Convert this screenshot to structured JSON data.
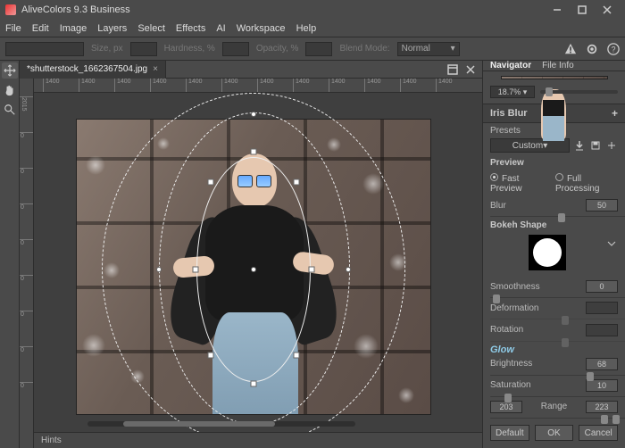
{
  "app": {
    "title": "AliveColors 9.3 Business"
  },
  "menu": [
    "File",
    "Edit",
    "Image",
    "Layers",
    "Select",
    "Effects",
    "AI",
    "Workspace",
    "Help"
  ],
  "options_bar": {
    "size_label": "Size, px",
    "hardness_label": "Hardness, %",
    "opacity_label": "Opacity, %",
    "blend_label": "Blend Mode:",
    "blend_value": "Normal"
  },
  "document": {
    "tab_name": "*shutterstock_1662367504.jpg"
  },
  "ruler_ticks": [
    "1400",
    "1400",
    "1400",
    "1400",
    "1400",
    "1400",
    "1400",
    "1400",
    "1400",
    "1400",
    "1400",
    "1400"
  ],
  "hints": {
    "label": "Hints"
  },
  "navigator": {
    "tabs": [
      "Navigator",
      "File Info"
    ],
    "zoom": "18.7%"
  },
  "iris_blur": {
    "title": "Iris Blur",
    "presets_label": "Presets",
    "preset_value": "Custom",
    "preview_label": "Preview",
    "fast_preview": "Fast Preview",
    "full_processing": "Full Processing",
    "blur_label": "Blur",
    "blur_value": "50",
    "bokeh_label": "Bokeh Shape",
    "smoothness_label": "Smoothness",
    "smoothness_value": "0",
    "deformation_label": "Deformation",
    "rotation_label": "Rotation",
    "glow_label": "Glow",
    "brightness_label": "Brightness",
    "brightness_value": "68",
    "saturation_label": "Saturation",
    "saturation_value": "10",
    "range_label": "Range",
    "range_low": "203",
    "range_high": "223"
  },
  "buttons": {
    "default": "Default",
    "ok": "OK",
    "cancel": "Cancel"
  }
}
